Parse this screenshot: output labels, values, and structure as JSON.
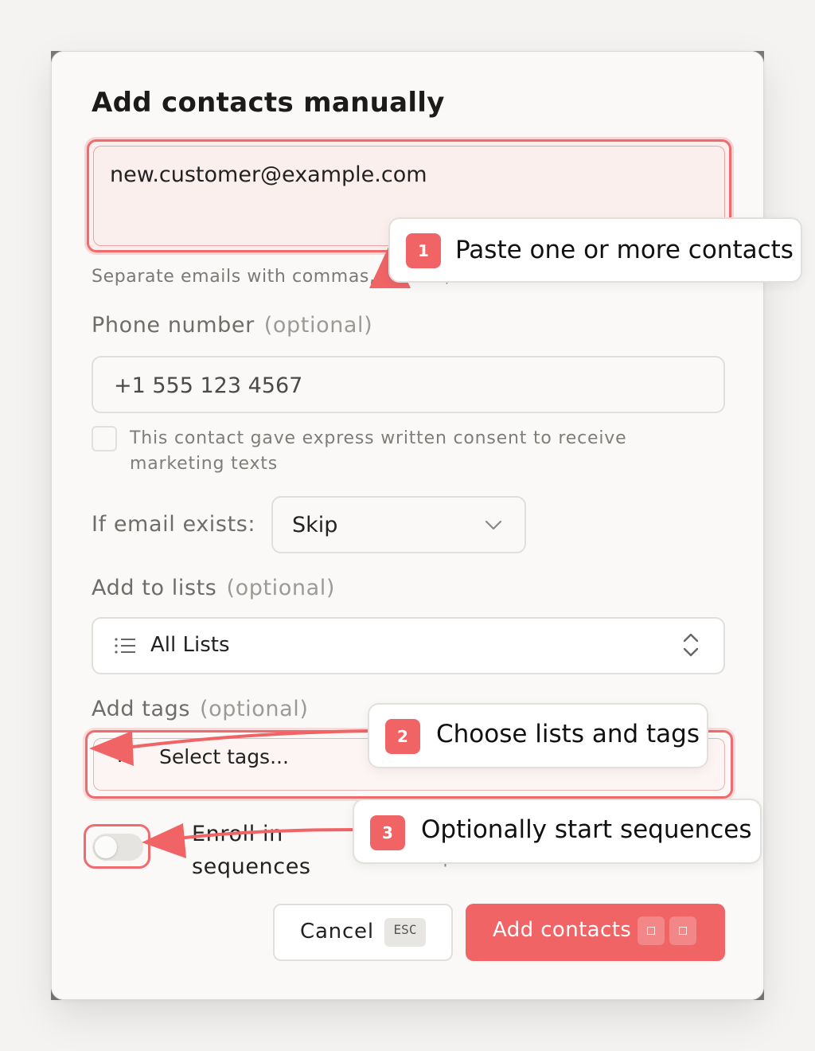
{
  "modal": {
    "title": "Add contacts manually",
    "email_value": "new.customer@example.com",
    "email_helper": "Separate emails with commas, spaces, or new lines.",
    "phone": {
      "label": "Phone number",
      "optional": "(optional)",
      "value": "+1 555 123 4567"
    },
    "consent_text": "This contact gave express written consent to receive marketing texts",
    "if_exists": {
      "label": "If email exists:",
      "selected": "Skip"
    },
    "lists": {
      "label": "Add to lists",
      "optional": "(optional)",
      "selected": "All Lists"
    },
    "tags": {
      "label": "Add tags",
      "optional": "(optional)",
      "placeholder": "Select tags..."
    },
    "enroll": {
      "label": "Enroll in sequences",
      "description": "email sequences",
      "enabled": false
    },
    "buttons": {
      "cancel": "Cancel",
      "cancel_shortcut": "ESC",
      "add": "Add contacts"
    }
  },
  "callouts": [
    {
      "number": "1",
      "text": "Paste one or more contacts"
    },
    {
      "number": "2",
      "text": "Choose lists and tags"
    },
    {
      "number": "3",
      "text": "Optionally start sequences"
    }
  ],
  "colors": {
    "accent": "#f06466",
    "highlight_border": "#ef6b6e",
    "background": "#f4f3f1",
    "modal_background": "#faf9f7"
  },
  "icons": [
    "list-icon",
    "chevron-down-icon",
    "up-down-chevron-icon",
    "plus-icon"
  ]
}
